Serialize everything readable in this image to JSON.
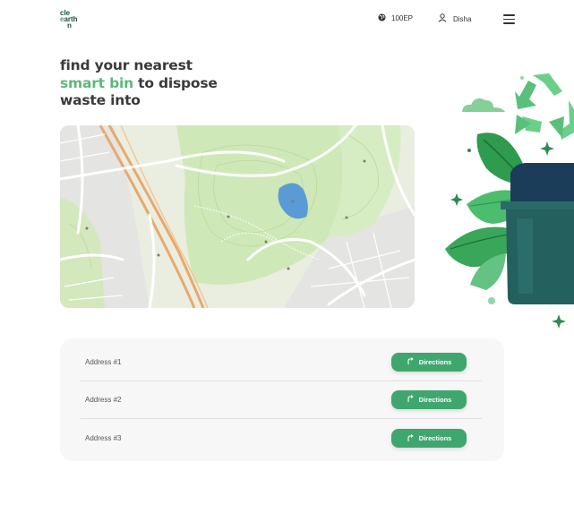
{
  "brand": {
    "logo_line1": "cle",
    "logo_line2a": "e",
    "logo_line2b": "arth",
    "logo_line3": "n"
  },
  "header": {
    "points": "100EP",
    "points_icon": "globe-icon",
    "user_name": "Disha",
    "user_icon": "user-icon",
    "menu_icon": "hamburger-menu-icon"
  },
  "hero": {
    "line1": "find your nearest",
    "highlight": "smart bin",
    "line2_rest": " to dispose",
    "line3": "waste into"
  },
  "addresses": [
    {
      "label": "Address #1",
      "button": "Directions"
    },
    {
      "label": "Address #2",
      "button": "Directions"
    },
    {
      "label": "Address #3",
      "button": "Directions"
    }
  ],
  "colors": {
    "accent": "#3fa66f",
    "highlight_text": "#5cb878",
    "bin": "#1f5a55",
    "card_bg": "#f7f7f7"
  }
}
